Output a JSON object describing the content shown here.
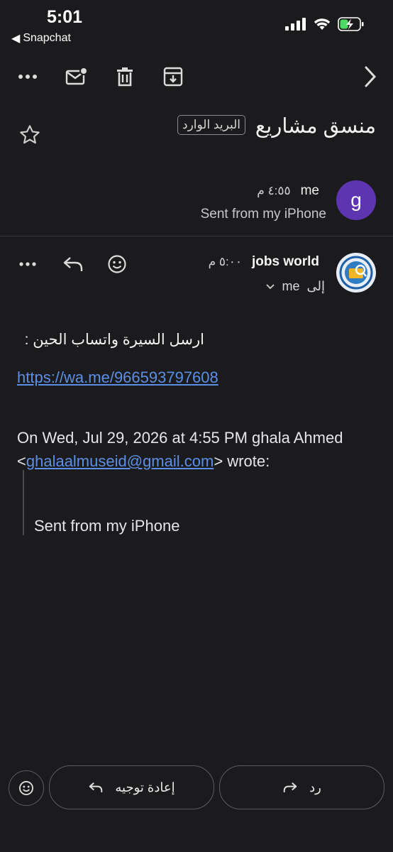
{
  "status_bar": {
    "time": "5:01",
    "back_app": "Snapchat"
  },
  "thread": {
    "subject": "منسق مشاريع",
    "label": "البريد الوارد"
  },
  "message1": {
    "avatar_letter": "g",
    "sender": "me",
    "time": "٤:٥٥ م",
    "snippet": "Sent from my iPhone"
  },
  "message2": {
    "sender": "jobs world",
    "time": "٥:٠٠ م",
    "to_prefix": "إلى",
    "to_value": "me",
    "body_line": "ارسل السيرة واتساب الحين :",
    "body_link": "https://wa.me/966593797608",
    "quote_prefix": "On Wed, Jul 29, 2026 at 4:55 PM ghala Ahmed <",
    "quote_email": "ghalaalmuseid@gmail.com",
    "quote_suffix": "> wrote:",
    "quote_text": "Sent from my iPhone"
  },
  "actions": {
    "forward_label": "إعادة توجيه",
    "reply_label": "رد"
  },
  "colors": {
    "background": "#1b1b1d",
    "link": "#5b8fe5",
    "avatar_g": "#5e35b1",
    "battery_charging": "#4cd964"
  }
}
